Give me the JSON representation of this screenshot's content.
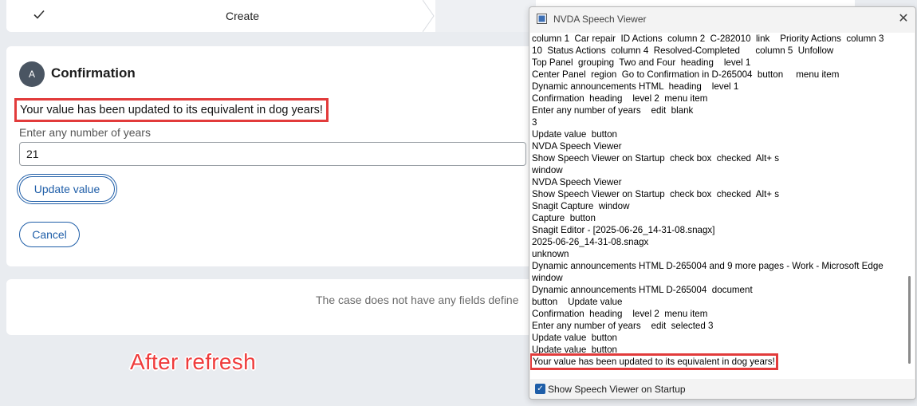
{
  "stepper": {
    "step_label": "Create"
  },
  "main_card": {
    "avatar_letter": "A",
    "title": "Confirmation",
    "announcement": "Your value has been updated to its equivalent in dog years!",
    "field_label": "Enter any number of years",
    "field_value": "21",
    "update_button": "Update value",
    "cancel_button": "Cancel"
  },
  "secondary_card": {
    "message": "The case does not have any fields define"
  },
  "annotation": "After refresh",
  "nvda": {
    "title": "NVDA Speech Viewer",
    "log": [
      "column 1  Car repair  ID Actions  column 2  C-282010  link    Priority Actions  column 3",
      "10  Status Actions  column 4  Resolved-Completed      column 5  Unfollow",
      "Top Panel  grouping  Two and Four  heading    level 1",
      "Center Panel  region  Go to Confirmation in D-265004  button     menu item",
      "Dynamic announcements HTML  heading    level 1",
      "Confirmation  heading    level 2  menu item",
      "Enter any number of years    edit  blank",
      "3",
      "Update value  button",
      "NVDA Speech Viewer",
      "Show Speech Viewer on Startup  check box  checked  Alt+ s",
      "window",
      "NVDA Speech Viewer",
      "Show Speech Viewer on Startup  check box  checked  Alt+ s",
      "Snagit Capture  window",
      "Capture  button",
      "Snagit Editor - [2025-06-26_14-31-08.snagx]",
      "2025-06-26_14-31-08.snagx",
      "unknown",
      "Dynamic announcements HTML D-265004 and 9 more pages - Work - Microsoft Edge",
      "window",
      "Dynamic announcements HTML D-265004  document",
      "button    Update value",
      "Confirmation  heading    level 2  menu item",
      "Enter any number of years    edit  selected 3",
      "Update value  button",
      "Update value  button"
    ],
    "highlighted_line": "Your value has been updated to its equivalent in dog years!",
    "startup_checkbox_label": "Show Speech Viewer on Startup",
    "startup_checked": true
  }
}
